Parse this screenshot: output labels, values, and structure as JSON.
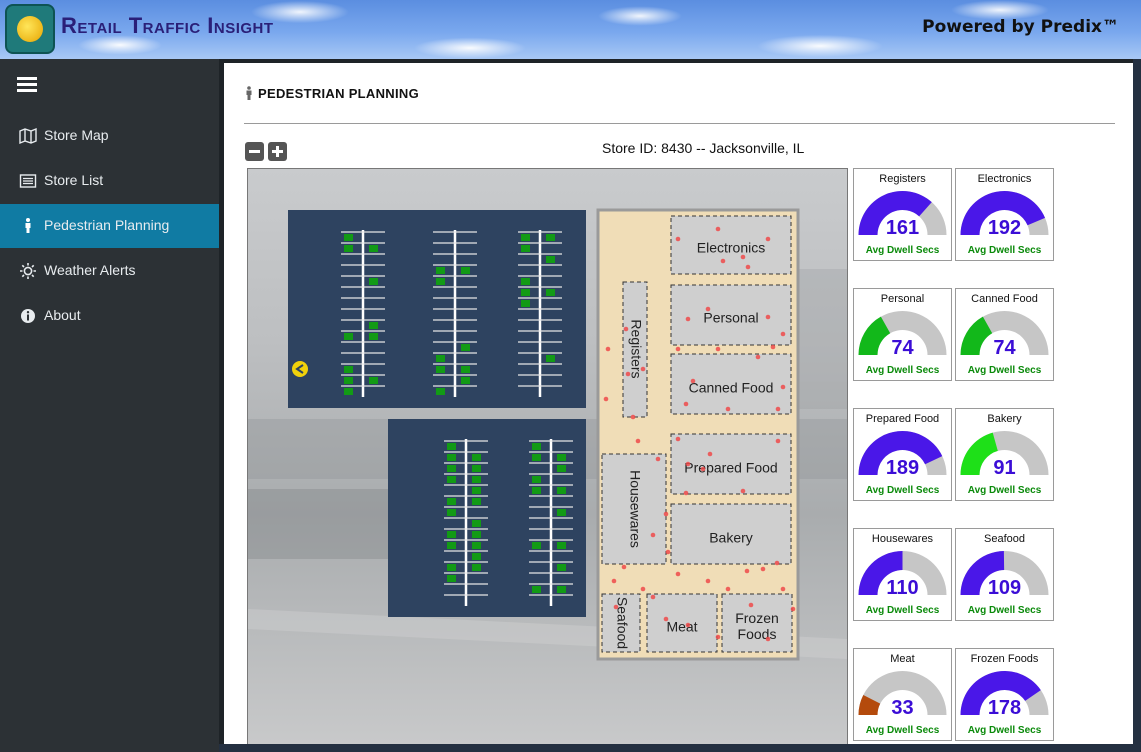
{
  "header": {
    "title": "Retail Traffic Insight",
    "powered_by": "Powered by Predix™"
  },
  "sidebar": {
    "items": [
      {
        "label": "Store Map",
        "icon": "map-icon",
        "active": false
      },
      {
        "label": "Store List",
        "icon": "list-icon",
        "active": false
      },
      {
        "label": "Pedestrian Planning",
        "icon": "pedestrian-icon",
        "active": true
      },
      {
        "label": "Weather Alerts",
        "icon": "sun-icon",
        "active": false
      },
      {
        "label": "About",
        "icon": "info-icon",
        "active": false
      }
    ]
  },
  "page": {
    "title": "PEDESTRIAN PLANNING",
    "store_id": "Store ID: 8430 -- Jacksonville, IL"
  },
  "store_map": {
    "departments": [
      "Electronics",
      "Personal",
      "Canned Food",
      "Prepared Food",
      "Bakery",
      "Registers",
      "Housewares",
      "Seafood",
      "Meat",
      "Frozen Foods"
    ]
  },
  "gauges": {
    "subtitle": "Avg Dwell Secs",
    "max": 220,
    "items": [
      {
        "name": "Registers",
        "value": 161,
        "color": "#4a17e8"
      },
      {
        "name": "Electronics",
        "value": 192,
        "color": "#4a17e8"
      },
      {
        "name": "Personal",
        "value": 74,
        "color": "#12b81a"
      },
      {
        "name": "Canned Food",
        "value": 74,
        "color": "#12b81a"
      },
      {
        "name": "Prepared Food",
        "value": 189,
        "color": "#4a17e8"
      },
      {
        "name": "Bakery",
        "value": 91,
        "color": "#1ee018"
      },
      {
        "name": "Housewares",
        "value": 110,
        "color": "#4a17e8"
      },
      {
        "name": "Seafood",
        "value": 109,
        "color": "#4a17e8"
      },
      {
        "name": "Meat",
        "value": 33,
        "color": "#b44a0c"
      },
      {
        "name": "Frozen Foods",
        "value": 178,
        "color": "#4a17e8"
      }
    ]
  }
}
